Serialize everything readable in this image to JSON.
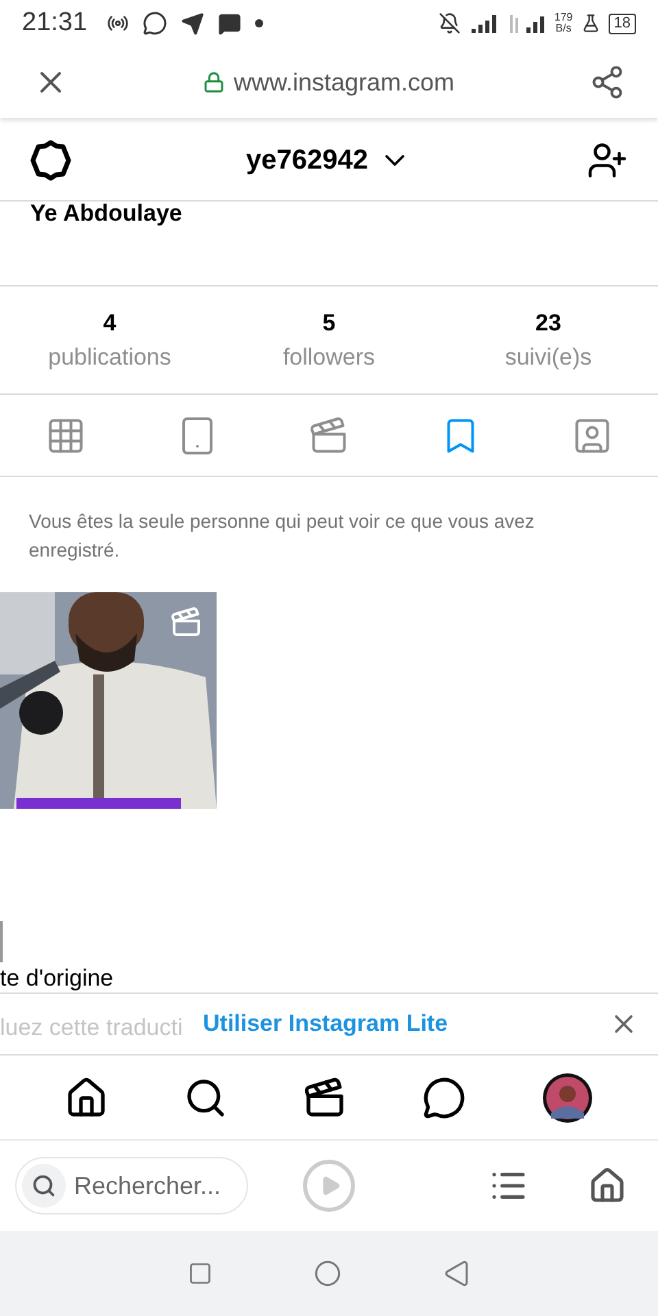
{
  "status_bar": {
    "time": "21:31",
    "speed": "179",
    "speed_unit": "B/s",
    "battery": "18"
  },
  "browser": {
    "url": "www.instagram.com"
  },
  "profile": {
    "username": "ye762942",
    "full_name": "Ye Abdoulaye"
  },
  "stats": [
    {
      "value": "4",
      "label": "publications"
    },
    {
      "value": "5",
      "label": "followers"
    },
    {
      "value": "23",
      "label": "suivi(e)s"
    }
  ],
  "tabs": [
    {
      "kind": "grid",
      "selected": false
    },
    {
      "kind": "feed",
      "selected": false
    },
    {
      "kind": "reels",
      "selected": false
    },
    {
      "kind": "saved",
      "selected": true
    },
    {
      "kind": "tagged",
      "selected": false
    }
  ],
  "saved_note": "Vous êtes la seule personne qui peut voir ce que vous avez enregistré.",
  "posts": [
    {
      "kind": "picture",
      "reel": true
    }
  ],
  "translation_fragments": [
    "te d'origine",
    "luez cette traducti"
  ],
  "banner": {
    "label": "Utiliser Instagram Lite"
  },
  "bottom_nav": [
    {
      "kind": "home"
    },
    {
      "kind": "search"
    },
    {
      "kind": "reels"
    },
    {
      "kind": "messenger"
    },
    {
      "kind": "avatar"
    }
  ],
  "browser_bar": {
    "search_placeholder": "Rechercher..."
  }
}
